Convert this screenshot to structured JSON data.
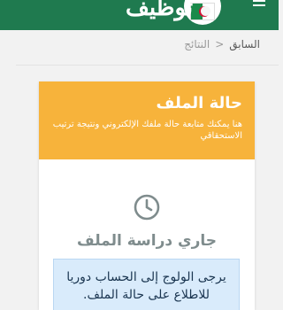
{
  "header": {
    "brand": "توظيف",
    "menu_icon": "hamburger-menu-icon",
    "logo_icon": "algeria-flag-icon"
  },
  "breadcrumb": {
    "back": "السابق",
    "separator": "<",
    "current": "النتائج"
  },
  "card": {
    "title": "حالة الملف",
    "subtitle": "هنا يمكنك متابعة حالة ملفك الإلكتروني ونتيجة ترتيب الاستحقاقي",
    "status_icon": "clock-icon",
    "status": "جاري دراسة الملف",
    "notice": "يرجى الولوج إلى الحساب دوريا للاطلاع على حالة الملف."
  },
  "colors": {
    "topbar": "#1f7a4f",
    "card_header": "#f7b33b",
    "notice_bg": "#d9ebfb",
    "status_text": "#7f8c8d"
  }
}
